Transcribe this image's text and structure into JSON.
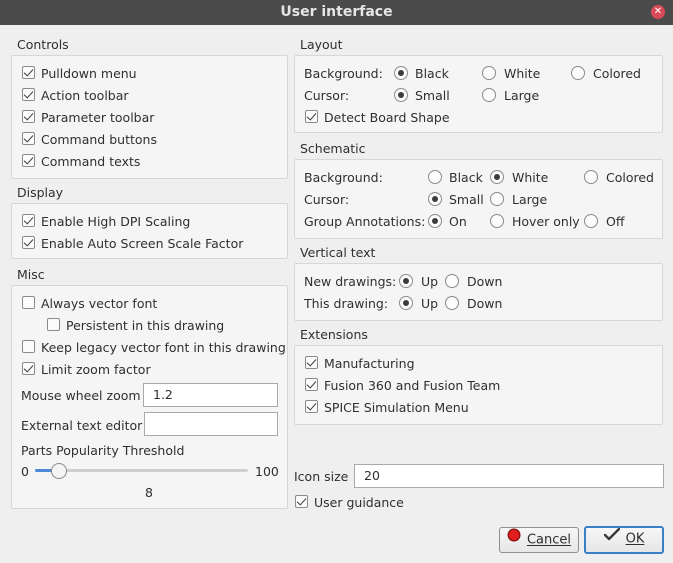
{
  "window": {
    "title": "User interface",
    "close_icon": "close-icon"
  },
  "controls": {
    "title": "Controls",
    "items": [
      {
        "label": "Pulldown menu",
        "checked": true
      },
      {
        "label": "Action toolbar",
        "checked": true
      },
      {
        "label": "Parameter toolbar",
        "checked": true
      },
      {
        "label": "Command buttons",
        "checked": true
      },
      {
        "label": "Command texts",
        "checked": true
      }
    ]
  },
  "display": {
    "title": "Display",
    "items": [
      {
        "label": "Enable High DPI Scaling",
        "checked": true
      },
      {
        "label": "Enable Auto Screen Scale Factor",
        "checked": true
      }
    ]
  },
  "misc": {
    "title": "Misc",
    "always_vector_font": "Always vector font",
    "persistent": "Persistent in this drawing",
    "keep_legacy": "Keep legacy vector font in this drawing",
    "limit_zoom": "Limit zoom factor",
    "mouse_wheel_zoom_label": "Mouse wheel zoom",
    "mouse_wheel_zoom_value": "1.2",
    "external_text_editor_label": "External text editor",
    "external_text_editor_value": "",
    "parts_popularity_label": "Parts Popularity Threshold",
    "slider_min": "0",
    "slider_max": "100",
    "slider_value": "8",
    "slider_fraction": 0.08
  },
  "layout": {
    "title": "Layout",
    "background_label": "Background:",
    "background_options": [
      "Black",
      "White",
      "Colored"
    ],
    "background_selected": "Black",
    "cursor_label": "Cursor:",
    "cursor_options": [
      "Small",
      "Large"
    ],
    "cursor_selected": "Small",
    "detect_board_shape": "Detect Board Shape"
  },
  "schematic": {
    "title": "Schematic",
    "background_label": "Background:",
    "background_options": [
      "Black",
      "White",
      "Colored"
    ],
    "background_selected": "White",
    "cursor_label": "Cursor:",
    "cursor_options": [
      "Small",
      "Large"
    ],
    "cursor_selected": "Small",
    "group_annotations_label": "Group Annotations:",
    "group_annotations_options": [
      "On",
      "Hover only",
      "Off"
    ],
    "group_annotations_selected": "On"
  },
  "vertical_text": {
    "title": "Vertical text",
    "new_drawings_label": "New drawings:",
    "this_drawing_label": "This drawing:",
    "options": [
      "Up",
      "Down"
    ],
    "new_selected": "Up",
    "this_selected": "Up"
  },
  "extensions": {
    "title": "Extensions",
    "items": [
      {
        "label": "Manufacturing",
        "checked": true
      },
      {
        "label": "Fusion 360 and Fusion Team",
        "checked": true
      },
      {
        "label": "SPICE Simulation Menu",
        "checked": true
      }
    ]
  },
  "icon_size": {
    "label": "Icon size",
    "value": "20"
  },
  "user_guidance": {
    "label": "User guidance",
    "checked": true
  },
  "buttons": {
    "cancel_label": "Cancel",
    "ok_label": "OK",
    "cancel_icon": "stop-circle-icon",
    "ok_icon": "checkmark-icon",
    "cancel_icon_color": "#e11d1d"
  }
}
